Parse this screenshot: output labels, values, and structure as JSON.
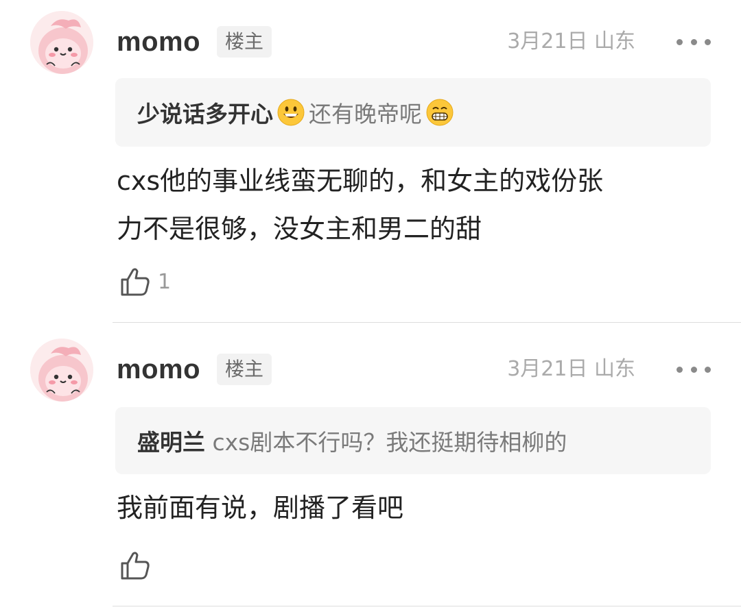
{
  "comments": [
    {
      "username": "momo",
      "badge": "楼主",
      "date": "3月21日",
      "location": "山东",
      "quote_author": "少说话多开心",
      "quote_emoji_1": "grinning-face-emoji",
      "quote_text": "还有晚帝呢",
      "quote_emoji_2": "beaming-face-emoji",
      "body_line_1": "cxs他的事业线蛮无聊的，和女主的戏份张",
      "body_line_2": "力不是很够，没女主和男二的甜",
      "like_count": "1"
    },
    {
      "username": "momo",
      "badge": "楼主",
      "date": "3月21日",
      "location": "山东",
      "quote_author": "盛明兰",
      "quote_text": " cxs剧本不行吗？我还挺期待相柳的",
      "body_line_1": "我前面有说，剧播了看吧",
      "like_count": ""
    }
  ],
  "icons": {
    "avatar": "pink-cartoon-avatar",
    "more": "more-dots-icon",
    "like": "thumbs-up-icon"
  }
}
